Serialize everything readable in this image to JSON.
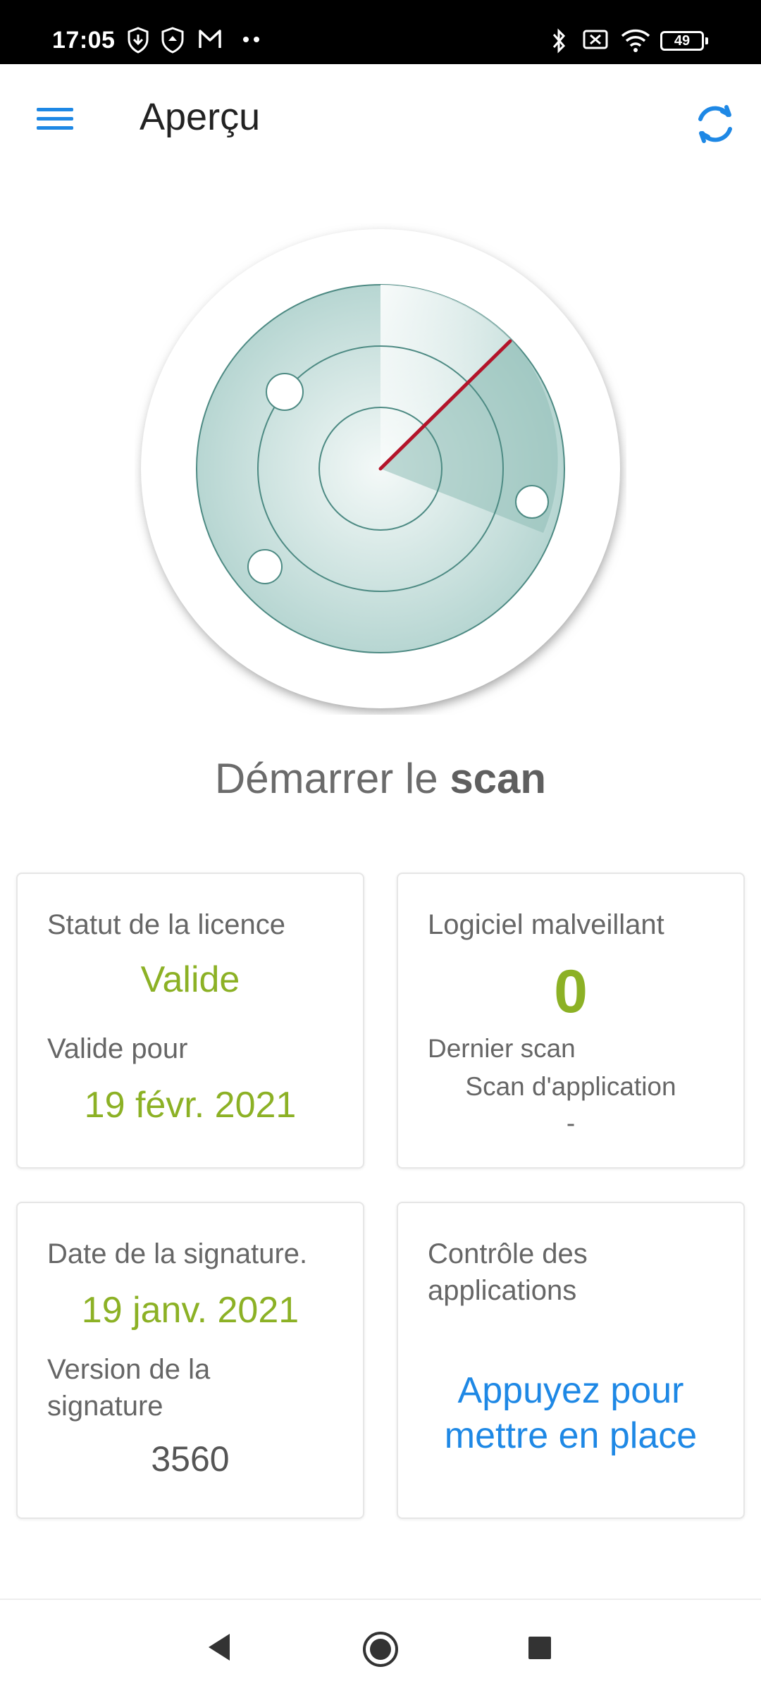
{
  "status_bar": {
    "time": "17:05",
    "icons_left": [
      "download-shield-icon",
      "shield-icon",
      "gmail-icon",
      "more-dots-icon"
    ],
    "icons_right": [
      "bluetooth-icon",
      "no-sim-icon",
      "wifi-icon",
      "battery-icon"
    ],
    "battery_level": "49"
  },
  "app_bar": {
    "title": "Aperçu",
    "menu_icon": "hamburger-menu-icon",
    "refresh_icon": "refresh-icon",
    "accent_color": "#1e88e5"
  },
  "radar": {
    "icon": "radar-icon"
  },
  "scan": {
    "prefix": "Démarrer le",
    "bold": "scan"
  },
  "cards": {
    "license": {
      "label": "Statut de la licence",
      "status": "Valide",
      "valid_for_label": "Valide pour",
      "valid_date": "19 févr. 2021"
    },
    "malware": {
      "label": "Logiciel malveillant",
      "count": "0",
      "last_scan_label": "Dernier scan",
      "last_scan_type": "Scan d'application",
      "last_scan_value": "-"
    },
    "signature": {
      "date_label": "Date de la signature.",
      "date_value": "19 janv. 2021",
      "version_label_line1": "Version de la",
      "version_label_line2": "signature",
      "version_value": "3560"
    },
    "app_control": {
      "label_line1": "Contrôle des",
      "label_line2": "applications",
      "action_line1": "Appuyez pour",
      "action_line2": "mettre en place"
    }
  },
  "colors": {
    "status_green": "#8cb125",
    "link_blue": "#1e88e5"
  },
  "nav_bar": {
    "back_icon": "back-triangle-icon",
    "home_icon": "home-circle-icon",
    "recents_icon": "recents-square-icon"
  }
}
